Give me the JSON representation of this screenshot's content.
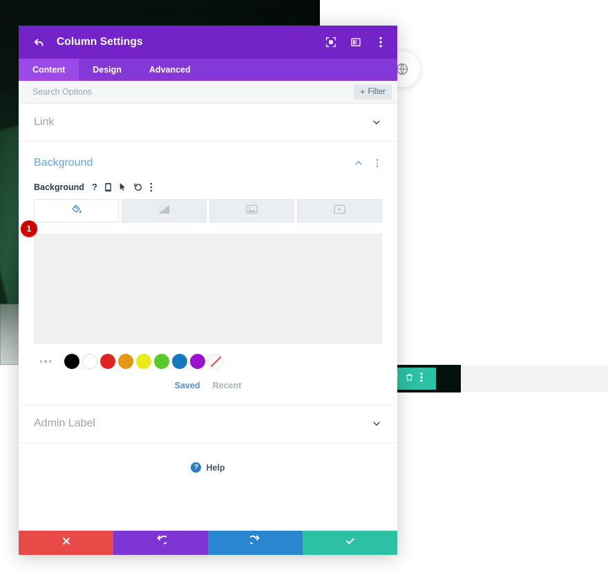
{
  "backdrop": {
    "globe_icon": "globe-icon",
    "element_toolbar": {
      "icons": [
        "duplicate-icon",
        "trash-icon",
        "more-vertical-icon"
      ]
    }
  },
  "modal": {
    "title": "Column Settings",
    "back_icon": "back-arrow-icon",
    "title_icons": [
      {
        "name": "focus-view-icon"
      },
      {
        "name": "panel-layout-icon"
      },
      {
        "name": "more-vertical-icon"
      }
    ],
    "tabs": [
      {
        "label": "Content",
        "active": true
      },
      {
        "label": "Design",
        "active": false
      },
      {
        "label": "Advanced",
        "active": false
      }
    ],
    "search": {
      "placeholder": "Search Options",
      "value": "",
      "filter_label": "Filter",
      "filter_plus": "+"
    },
    "sections": [
      {
        "name": "link",
        "label": "Link",
        "state": "collapsed"
      },
      {
        "name": "background",
        "label": "Background",
        "state": "expanded"
      },
      {
        "name": "admin_label",
        "label": "Admin Label",
        "state": "collapsed"
      }
    ],
    "background": {
      "field_label": "Background",
      "field_icons": [
        {
          "name": "help-question-icon",
          "glyph": "?"
        },
        {
          "name": "responsive-phone-icon"
        },
        {
          "name": "hover-cursor-icon"
        },
        {
          "name": "reset-undo-icon"
        },
        {
          "name": "more-vertical-icon"
        }
      ],
      "type_tabs": [
        {
          "name": "background-color-tab",
          "icon": "paint-bucket-icon",
          "active": true
        },
        {
          "name": "background-gradient-tab",
          "icon": "gradient-icon",
          "active": false
        },
        {
          "name": "background-image-tab",
          "icon": "image-icon",
          "active": false
        },
        {
          "name": "background-video-tab",
          "icon": "video-icon",
          "active": false
        }
      ],
      "step_badge": "1",
      "preview_color": "#f0f0f0",
      "swatches": [
        {
          "name": "swatch-more",
          "type": "ellipsis"
        },
        {
          "name": "swatch-black",
          "color": "#000000"
        },
        {
          "name": "swatch-white",
          "color": "#ffffff"
        },
        {
          "name": "swatch-red",
          "color": "#e02424"
        },
        {
          "name": "swatch-orange",
          "color": "#e59818"
        },
        {
          "name": "swatch-yellow",
          "color": "#eaea1e"
        },
        {
          "name": "swatch-green",
          "color": "#5cc92a"
        },
        {
          "name": "swatch-blue",
          "color": "#1878bf"
        },
        {
          "name": "swatch-purple",
          "color": "#9c13cf"
        },
        {
          "name": "swatch-transparent",
          "color": "none"
        }
      ],
      "palette_tabs": [
        {
          "label": "Saved",
          "active": true
        },
        {
          "label": "Recent",
          "active": false
        }
      ]
    },
    "help": {
      "label": "Help",
      "icon": "help-question-icon",
      "glyph": "?"
    },
    "footer_buttons": [
      {
        "name": "cancel-button",
        "icon": "close-x-icon",
        "color": "#e84a48"
      },
      {
        "name": "undo-button",
        "icon": "undo-icon",
        "color": "#7f35d4"
      },
      {
        "name": "redo-button",
        "icon": "redo-icon",
        "color": "#2887d0"
      },
      {
        "name": "save-button",
        "icon": "checkmark-icon",
        "color": "#2cc1a4"
      }
    ]
  }
}
